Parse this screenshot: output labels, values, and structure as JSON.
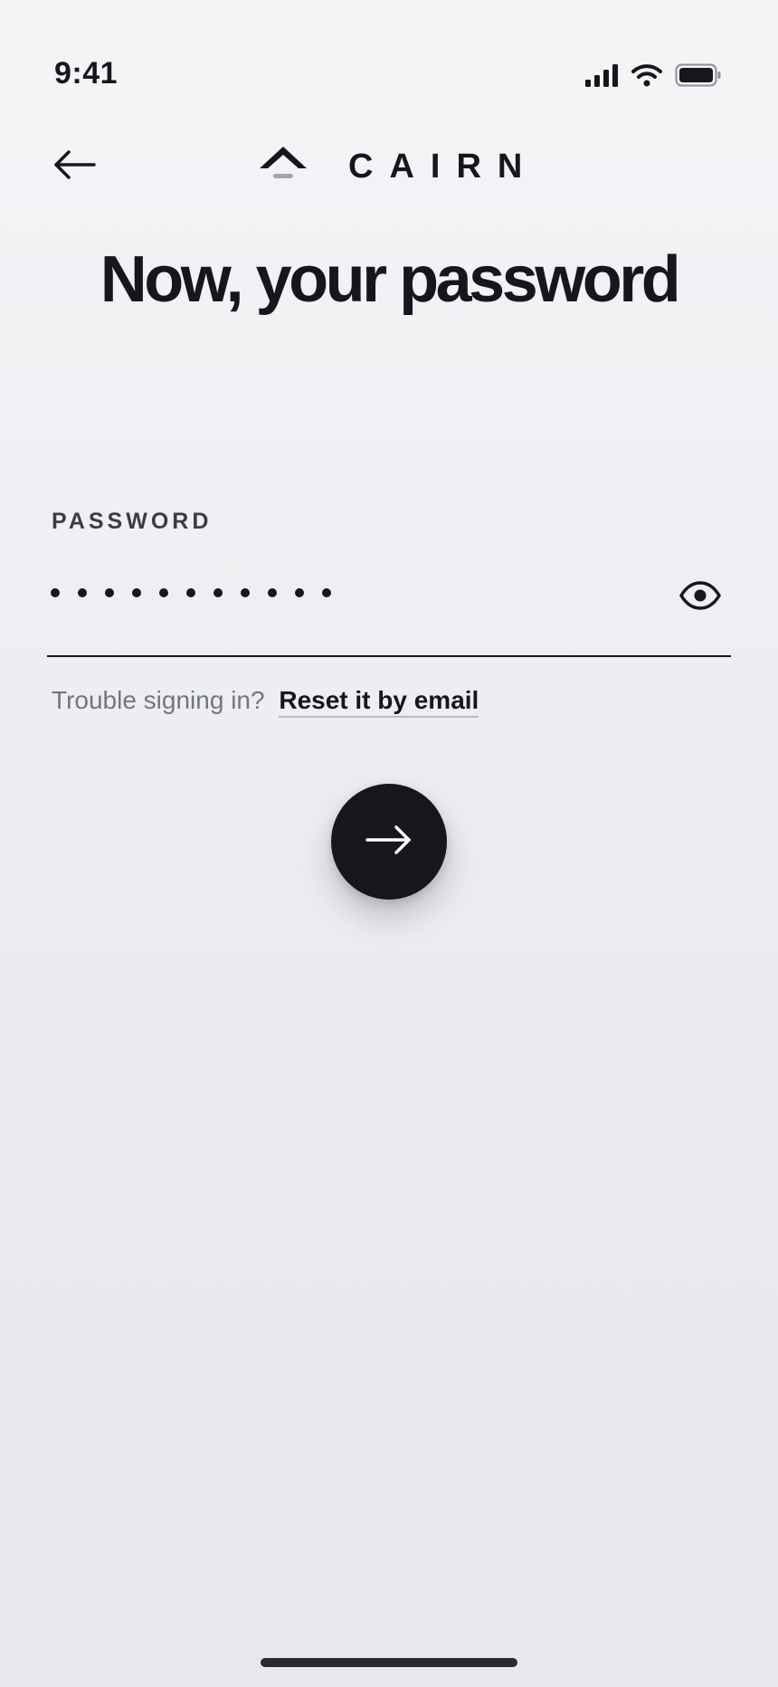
{
  "status_bar": {
    "time": "9:41",
    "icons": [
      "cellular-signal-icon",
      "wifi-icon",
      "battery-icon"
    ]
  },
  "nav": {
    "back_icon": "arrow-left-icon",
    "logo_icon": "mountain-peak-icon",
    "brand_name": "CAIRN"
  },
  "page": {
    "title": "Now, your password"
  },
  "password_field": {
    "label": "PASSWORD",
    "masked_length": 11,
    "visibility_icon": "eye-icon"
  },
  "help": {
    "text": "Trouble signing in?",
    "link": "Reset it by email"
  },
  "submit": {
    "icon": "arrow-right-icon"
  },
  "colors": {
    "ink": "#16171b",
    "muted": "#73767d",
    "background": "#eff0f3"
  }
}
